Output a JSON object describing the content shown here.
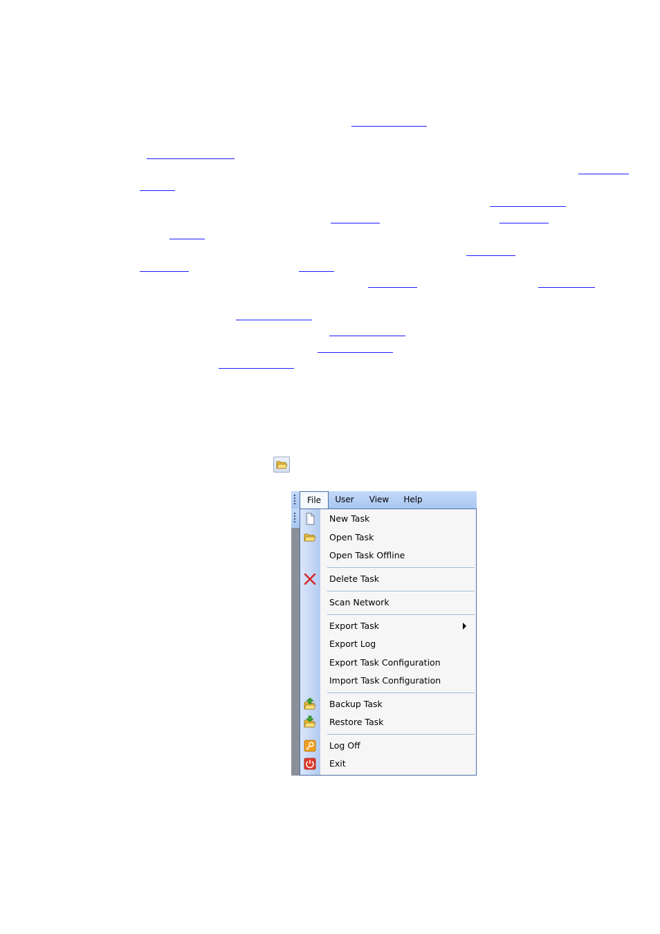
{
  "menubar": {
    "items": [
      {
        "label": "File",
        "active": true
      },
      {
        "label": "User"
      },
      {
        "label": "View"
      },
      {
        "label": "Help"
      }
    ]
  },
  "file_menu": {
    "items": [
      {
        "label": "New Task",
        "icon": "new-task-icon"
      },
      {
        "label": "Open Task",
        "icon": "folder-open-icon"
      },
      {
        "label": "Open Task Offline"
      },
      {
        "label": "Delete Task",
        "icon": "delete-x-icon"
      },
      {
        "label": "Scan Network"
      },
      {
        "label": "Export Task",
        "has_submenu": true
      },
      {
        "label": "Export Log"
      },
      {
        "label": "Export Task Configuration"
      },
      {
        "label": "Import Task Configuration"
      },
      {
        "label": "Backup Task",
        "icon": "backup-folder-icon"
      },
      {
        "label": "Restore Task",
        "icon": "restore-folder-icon"
      },
      {
        "label": "Log Off",
        "icon": "key-icon"
      },
      {
        "label": "Exit",
        "icon": "power-icon"
      }
    ]
  },
  "colors": {
    "link_underline": "#1a1aff",
    "menubar_bg": "#a8c6f1",
    "icon_column": "#b3cbf0",
    "menu_border": "#4b6fa8",
    "delete_red": "#d92525"
  }
}
